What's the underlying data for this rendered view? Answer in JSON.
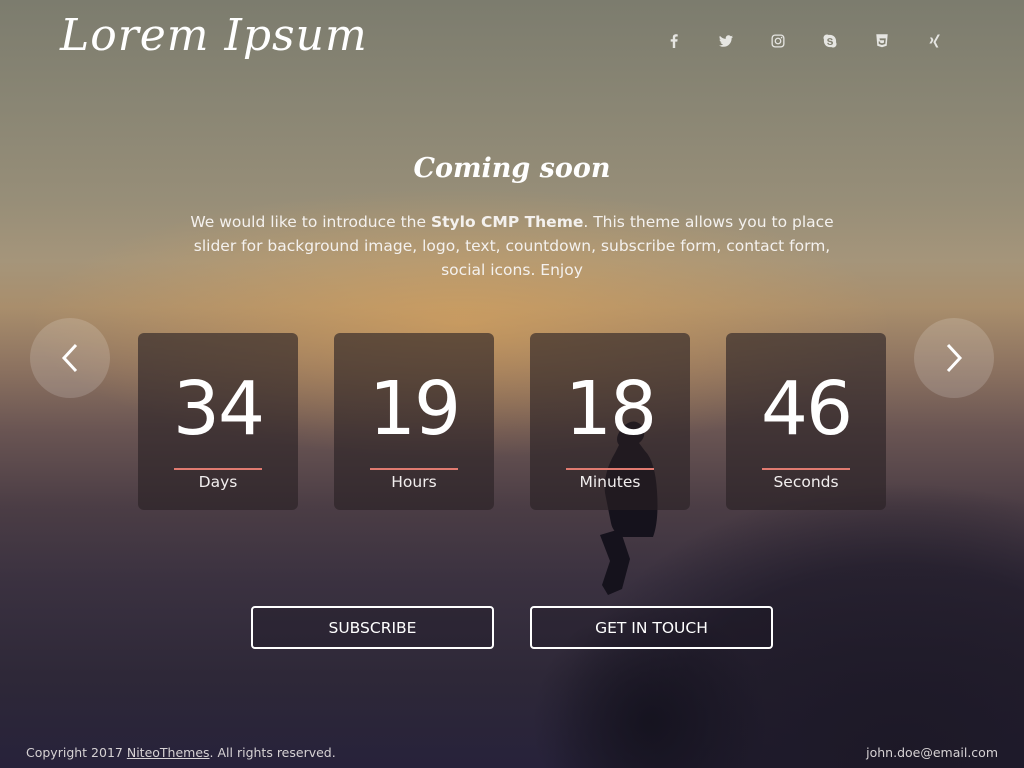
{
  "brand": {
    "logo": "Lorem Ipsum"
  },
  "social": [
    {
      "icon": "facebook-icon",
      "glyph": "f"
    },
    {
      "icon": "twitter-icon",
      "glyph": "t"
    },
    {
      "icon": "instagram-icon",
      "glyph": "i"
    },
    {
      "icon": "skype-icon",
      "glyph": "S"
    },
    {
      "icon": "html5-icon",
      "glyph": "5"
    },
    {
      "icon": "xing-icon",
      "glyph": "x"
    }
  ],
  "hero": {
    "headline": "Coming soon",
    "intro_before": "We would like to introduce the ",
    "intro_bold": "Stylo CMP Theme",
    "intro_after": ".  This theme allows you to place slider for background image, logo, text, countdown, subscribe form, contact form, social icons. Enjoy"
  },
  "countdown": [
    {
      "value": "34",
      "label": "Days"
    },
    {
      "value": "19",
      "label": "Hours"
    },
    {
      "value": "18",
      "label": "Minutes"
    },
    {
      "value": "46",
      "label": "Seconds"
    }
  ],
  "buttons": {
    "subscribe": "SUBSCRIBE",
    "touch": "GET IN TOUCH"
  },
  "footer": {
    "copyright_before": "Copyright 2017 ",
    "company": "NiteoThemes",
    "copyright_after": ". All rights reserved.",
    "email": "john.doe@email.com"
  },
  "colors": {
    "accent_underline": "#e07a70"
  }
}
